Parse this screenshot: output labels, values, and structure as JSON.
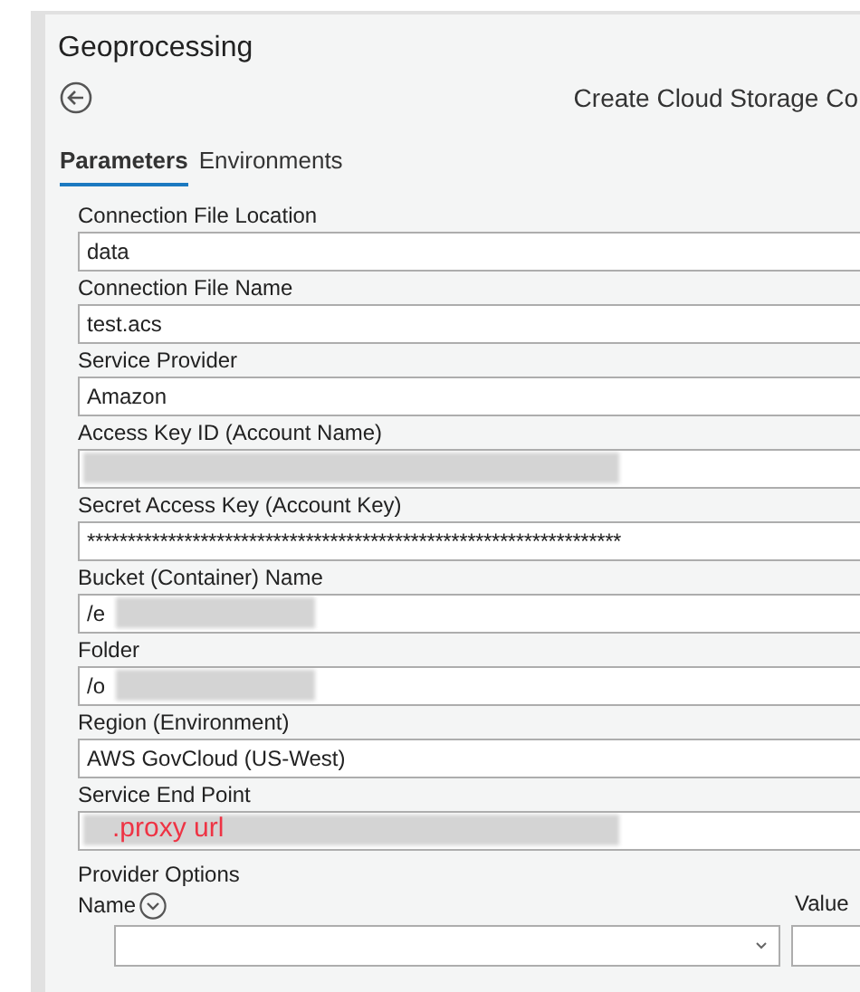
{
  "pane": {
    "title": "Geoprocessing",
    "tool_title": "Create Cloud Storage Co"
  },
  "tabs": [
    {
      "label": "Parameters",
      "selected": true
    },
    {
      "label": "Environments",
      "selected": false
    }
  ],
  "parameters": [
    {
      "label": "Connection File Location",
      "value": "data"
    },
    {
      "label": "Connection File Name",
      "value": "test.acs"
    },
    {
      "label": "Service Provider",
      "value": "Amazon"
    },
    {
      "label": "Access Key ID (Account Name)",
      "redacted": true
    },
    {
      "label": "Secret Access Key (Account Key)",
      "value": "******************************************************************"
    },
    {
      "label": "Bucket (Container) Name",
      "value": "/e",
      "redacted": true
    },
    {
      "label": "Folder",
      "value": "/o",
      "redacted": true
    },
    {
      "label": "Region (Environment)",
      "value": "AWS GovCloud (US-West)"
    },
    {
      "label": "Service End Point",
      "annotation": ".proxy url",
      "redacted": true
    }
  ],
  "provider_options": {
    "label": "Provider Options",
    "columns": [
      "Name",
      "Value"
    ]
  }
}
